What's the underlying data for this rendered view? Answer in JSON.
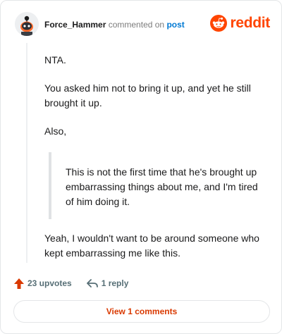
{
  "comment": {
    "author": "Force_Hammer",
    "verb": "commented on",
    "target_link": "post",
    "paragraphs_before": [
      "NTA.",
      "You asked him not to bring it up, and yet he still brought it up.",
      "Also,"
    ],
    "quote": "This is not the first time that he's brought up embarrassing things about me, and I'm tired of him doing it.",
    "paragraphs_after": [
      "Yeah, I wouldn't want to be around someone who kept embarrassing me like this."
    ]
  },
  "brand": {
    "name": "reddit",
    "color": "#ff4500"
  },
  "actions": {
    "upvotes": "23 upvotes",
    "replies": "1 reply",
    "upvote_icon": "upvote-arrow-icon",
    "reply_icon": "reply-arrow-icon"
  },
  "footer": {
    "view_comments": "View 1 comments"
  },
  "colors": {
    "accent": "#ff4500",
    "link": "#0079d3",
    "muted": "#576f76",
    "button_text": "#d93900"
  }
}
